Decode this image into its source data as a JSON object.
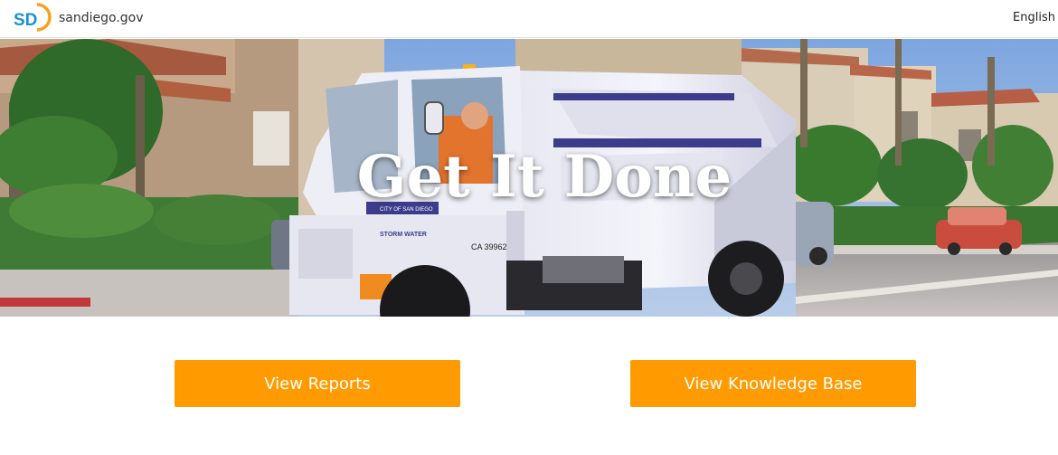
{
  "header": {
    "logo_text": "SD",
    "site_name": "sandiego.gov",
    "language": "English"
  },
  "hero": {
    "title": "Get It Done",
    "truck_text": {
      "city": "CITY OF SAN DIEGO",
      "department": "STORM WATER",
      "plate": "CA 39962"
    }
  },
  "actions": {
    "reports_label": "View Reports",
    "knowledge_base_label": "View Knowledge Base"
  },
  "colors": {
    "accent": "#ff9b00",
    "logo_blue": "#1b8fd4",
    "logo_orange": "#f7a21b"
  }
}
